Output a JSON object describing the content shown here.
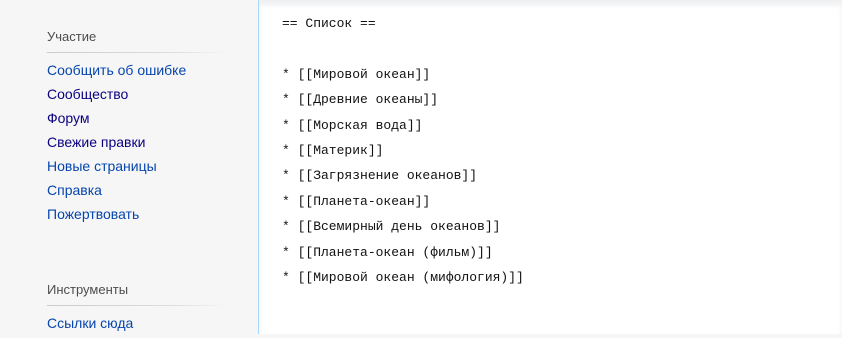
{
  "sidebar": {
    "participation_heading": "Участие",
    "participation_links": [
      "Сообщить об ошибке",
      "Сообщество",
      "Форум",
      "Свежие правки",
      "Новые страницы",
      "Справка",
      "Пожертвовать"
    ],
    "tools_heading": "Инструменты",
    "tools_links": [
      "Ссылки сюда"
    ]
  },
  "editor": {
    "lines": [
      "== Список ==",
      "",
      "* [[Мировой океан]]",
      "* [[Древние океаны]]",
      "* [[Морская вода]]",
      "* [[Материк]]",
      "* [[Загрязнение океанов]]",
      "* [[Планета-океан]]",
      "* [[Всемирный день океанов]]",
      "* [[Планета-океан (фильм)]]",
      "* [[Мировой океан (мифология)]]"
    ]
  },
  "colors": {
    "link": "#0645ad",
    "link_visited": "#0b0080",
    "heading": "#4d4d4d",
    "sidebar_bg": "#f6f6f6",
    "editor_border": "#a7d7f9"
  }
}
